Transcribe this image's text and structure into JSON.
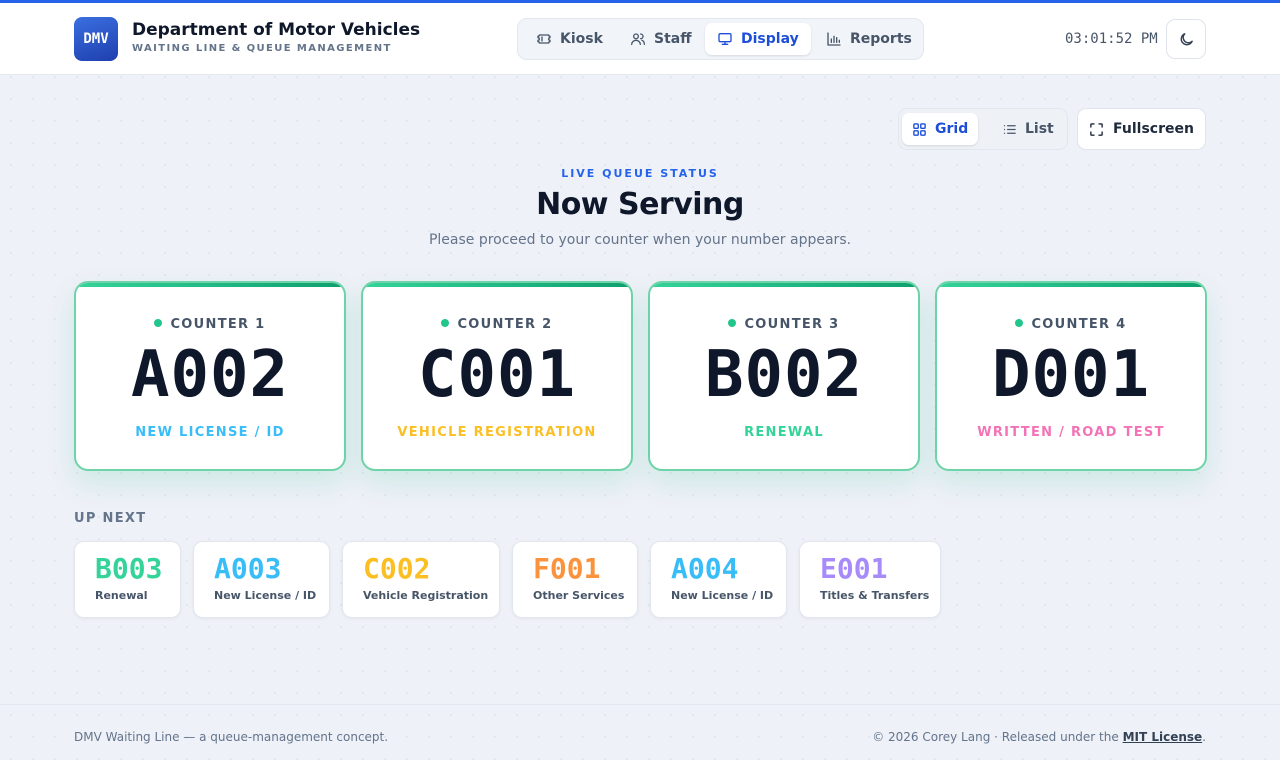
{
  "header": {
    "logo_text": "DMV",
    "title": "Department of Motor Vehicles",
    "subtitle": "WAITING LINE & QUEUE MANAGEMENT",
    "nav": [
      {
        "label": "Kiosk",
        "icon": "ticket-icon",
        "active": false
      },
      {
        "label": "Staff",
        "icon": "users-icon",
        "active": false
      },
      {
        "label": "Display",
        "icon": "monitor-icon",
        "active": true
      },
      {
        "label": "Reports",
        "icon": "bar-chart-icon",
        "active": false
      }
    ],
    "clock": "03:01:52 PM",
    "theme_icon": "moon-icon"
  },
  "toolbar": {
    "view_options": [
      {
        "label": "Grid",
        "icon": "grid-icon",
        "active": true
      },
      {
        "label": "List",
        "icon": "list-icon",
        "active": false
      }
    ],
    "fullscreen_label": "Fullscreen"
  },
  "hero": {
    "eyebrow": "LIVE QUEUE STATUS",
    "title": "Now Serving",
    "subtitle": "Please proceed to your counter when your number appears."
  },
  "counters": [
    {
      "label": "COUNTER 1",
      "ticket": "A002",
      "service": "NEW LICENSE / ID",
      "color": "#38bdf8"
    },
    {
      "label": "COUNTER 2",
      "ticket": "C001",
      "service": "VEHICLE REGISTRATION",
      "color": "#fbbf24"
    },
    {
      "label": "COUNTER 3",
      "ticket": "B002",
      "service": "RENEWAL",
      "color": "#34d399"
    },
    {
      "label": "COUNTER 4",
      "ticket": "D001",
      "service": "WRITTEN / ROAD TEST",
      "color": "#f472b6"
    }
  ],
  "up_next": {
    "label": "UP NEXT",
    "items": [
      {
        "ticket": "B003",
        "service": "Renewal",
        "color": "#34d399"
      },
      {
        "ticket": "A003",
        "service": "New License / ID",
        "color": "#38bdf8"
      },
      {
        "ticket": "C002",
        "service": "Vehicle Registration",
        "color": "#fbbf24"
      },
      {
        "ticket": "F001",
        "service": "Other Services",
        "color": "#fb923c"
      },
      {
        "ticket": "A004",
        "service": "New License / ID",
        "color": "#38bdf8"
      },
      {
        "ticket": "E001",
        "service": "Titles & Transfers",
        "color": "#a78bfa"
      }
    ]
  },
  "footer": {
    "left": "DMV Waiting Line — a queue-management concept.",
    "right_prefix": "© 2026 Corey Lang · Released under the ",
    "license_link": "MIT License",
    "right_suffix": "."
  },
  "colors": {
    "accent": "#2563eb",
    "serving_border": "#6ed3a8"
  }
}
